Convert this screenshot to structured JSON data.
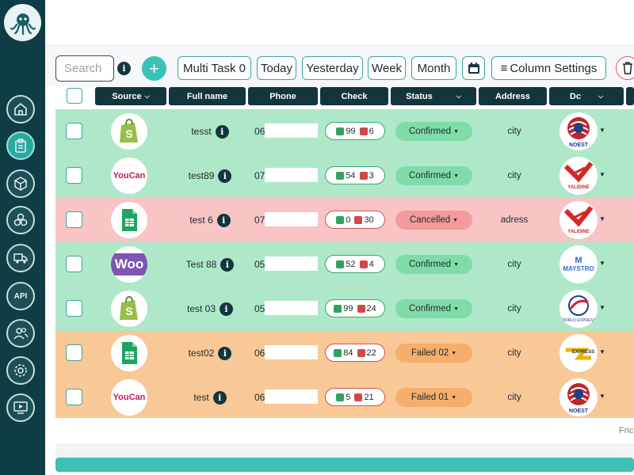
{
  "sidebar": {
    "items": [
      {
        "icon": "home-icon"
      },
      {
        "icon": "clipboard-icon",
        "active": true
      },
      {
        "icon": "box-icon"
      },
      {
        "icon": "boxes-icon"
      },
      {
        "icon": "delivery-truck-icon"
      },
      {
        "icon": "api-icon",
        "label": "API"
      },
      {
        "icon": "users-icon"
      },
      {
        "icon": "settings-gear-icon"
      },
      {
        "icon": "video-tutorial-icon"
      }
    ]
  },
  "filters": {
    "search_placeholder": "Search",
    "info": "i",
    "add": "+",
    "multi_task": "Multi Task 0",
    "today": "Today",
    "yesterday": "Yesterday",
    "week": "Week",
    "month": "Month",
    "column_settings": "Column Settings"
  },
  "table": {
    "headers": {
      "source": "Source",
      "full_name": "Full name",
      "phone": "Phone",
      "check": "Check",
      "status": "Status",
      "address": "Address",
      "dc": "Dc"
    },
    "rows": [
      {
        "source": "shopify",
        "name": "tesst",
        "phone_prefix": "06",
        "check_ok": "99",
        "check_ko": "6",
        "status": "Confirmed",
        "address": "city",
        "dc": "NOEST"
      },
      {
        "source": "YouCan",
        "name": "test89",
        "phone_prefix": "07",
        "check_ok": "54",
        "check_ko": "3",
        "status": "Confirmed",
        "address": "city",
        "dc": "YALIDINE"
      },
      {
        "source": "sheets",
        "name": "test 6",
        "phone_prefix": "07",
        "check_ok": "0",
        "check_ko": "30",
        "status": "Cancelled",
        "address": "adress",
        "dc": "YALIDINE"
      },
      {
        "source": "Woo",
        "name": "Test 88",
        "phone_prefix": "05",
        "check_ok": "52",
        "check_ko": "4",
        "status": "Confirmed",
        "address": "city",
        "dc": "MAYSTRO"
      },
      {
        "source": "shopify",
        "name": "test 03",
        "phone_prefix": "05",
        "check_ok": "99",
        "check_ko": "24",
        "status": "Confirmed",
        "address": "city",
        "dc": "WORLD EXPRESS"
      },
      {
        "source": "sheets",
        "name": "test02",
        "phone_prefix": "06",
        "check_ok": "84",
        "check_ko": "22",
        "status": "Failed 02",
        "address": "city",
        "dc": "ZR EXPRESS"
      },
      {
        "source": "YouCan",
        "name": "test",
        "phone_prefix": "06",
        "check_ok": "5",
        "check_ko": "21",
        "status": "Failed 01",
        "address": "city",
        "dc": "NOEST"
      }
    ]
  },
  "footer": {
    "partial_text": "Fric"
  }
}
